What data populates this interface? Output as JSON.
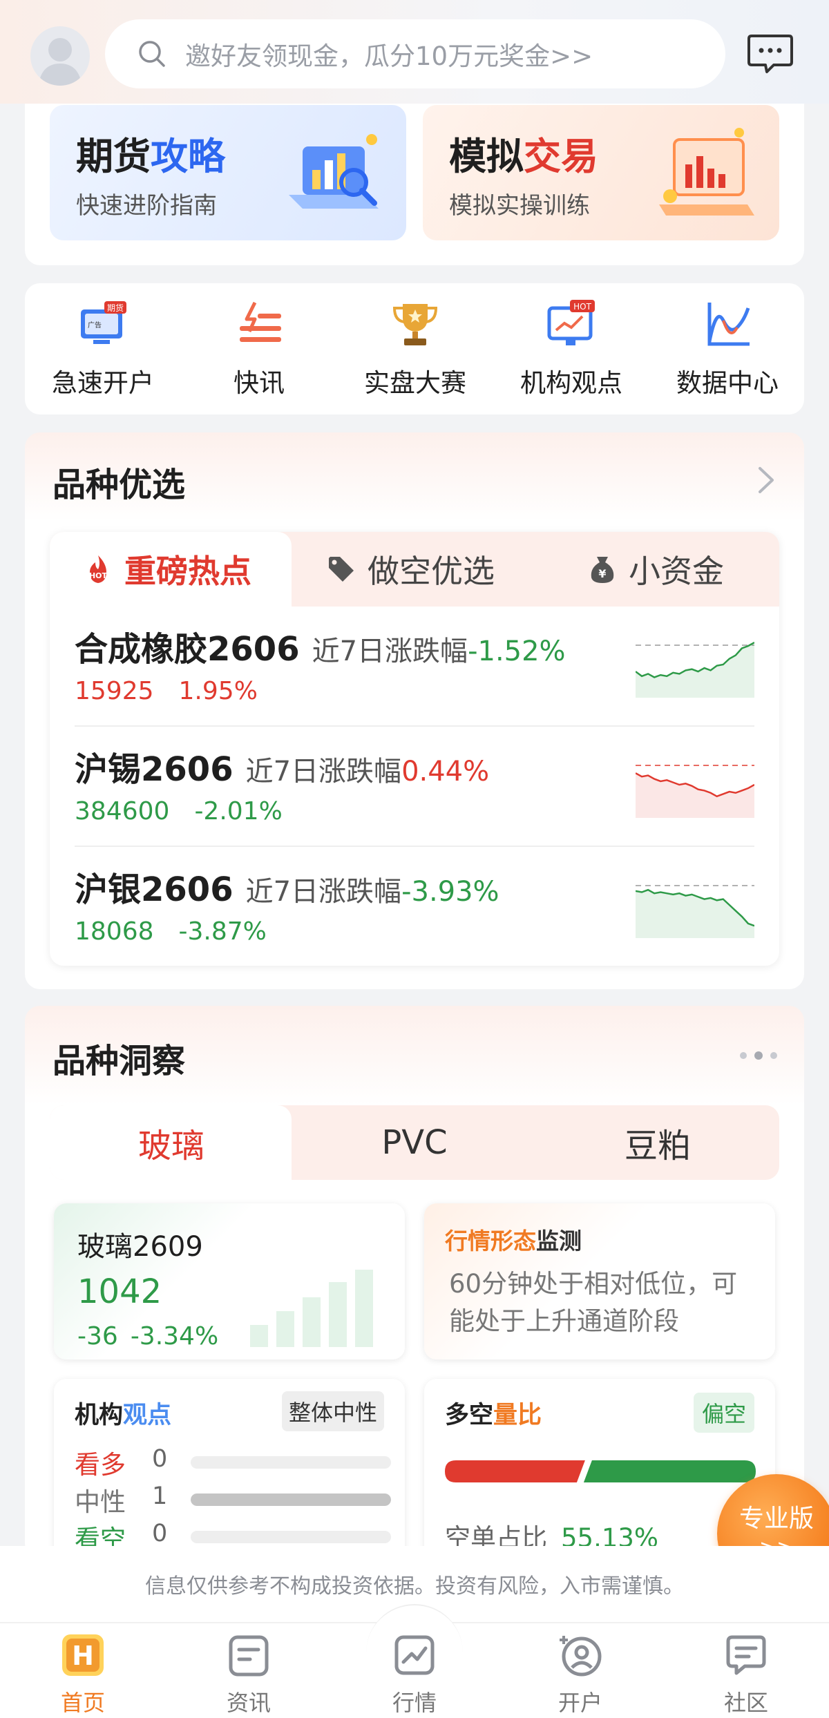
{
  "search": {
    "placeholder": "邀好友领现金，瓜分10万元奖金>>"
  },
  "banners": [
    {
      "title_a": "期货",
      "title_b": "攻略",
      "subtitle": "快速进阶指南"
    },
    {
      "title_a": "模拟",
      "title_b": "交易",
      "subtitle": "模拟实操训练"
    }
  ],
  "quick": {
    "items": [
      {
        "label": "急速开户",
        "icon": "account-monitor-icon",
        "badge": "期货",
        "badge2": "广告"
      },
      {
        "label": "快讯",
        "icon": "news-flash-icon"
      },
      {
        "label": "实盘大赛",
        "icon": "trophy-icon"
      },
      {
        "label": "机构观点",
        "icon": "hot-board-icon",
        "badge": "HOT"
      },
      {
        "label": "数据中心",
        "icon": "data-chart-icon"
      }
    ]
  },
  "picks": {
    "title": "品种优选",
    "tabs": [
      {
        "label": "重磅热点",
        "icon": "hot-fire-icon",
        "icon_text": "HOT"
      },
      {
        "label": "做空优选",
        "icon": "tag-icon"
      },
      {
        "label": "小资金",
        "icon": "money-bag-icon",
        "icon_text": "¥"
      }
    ],
    "rows": [
      {
        "name": "合成橡胶2606",
        "range_label": "近7日涨跌幅",
        "range_pct": "-1.52%",
        "price": "15925",
        "change": "1.95%",
        "price_dir": "up",
        "range_dir": "dn",
        "spark": [
          0.62,
          0.7,
          0.66,
          0.72,
          0.68,
          0.7,
          0.64,
          0.66,
          0.6,
          0.58,
          0.62,
          0.56,
          0.6,
          0.52,
          0.5,
          0.4,
          0.34,
          0.22,
          0.18,
          0.12
        ]
      },
      {
        "name": "沪锡2606",
        "range_label": "近7日涨跌幅",
        "range_pct": "0.44%",
        "price": "384600",
        "change": "-2.01%",
        "price_dir": "dn",
        "range_dir": "up",
        "spark": [
          0.3,
          0.36,
          0.34,
          0.4,
          0.44,
          0.42,
          0.46,
          0.5,
          0.48,
          0.52,
          0.58,
          0.6,
          0.64,
          0.7,
          0.66,
          0.62,
          0.64,
          0.6,
          0.56,
          0.5
        ]
      },
      {
        "name": "沪银2606",
        "range_label": "近7日涨跌幅",
        "range_pct": "-3.93%",
        "price": "18068",
        "change": "-3.87%",
        "price_dir": "dn",
        "range_dir": "dn",
        "spark": [
          0.26,
          0.28,
          0.24,
          0.3,
          0.28,
          0.3,
          0.32,
          0.3,
          0.34,
          0.32,
          0.36,
          0.4,
          0.38,
          0.42,
          0.4,
          0.5,
          0.6,
          0.7,
          0.82,
          0.86
        ]
      }
    ]
  },
  "insight": {
    "title": "品种洞察",
    "tabs": [
      "玻璃",
      "PVC",
      "豆粕"
    ],
    "quote": {
      "name": "玻璃2609",
      "price": "1042",
      "change": "-36",
      "change_pct": "-3.34%"
    },
    "pattern": {
      "title_hl": "行情形态",
      "title_rest": "监测",
      "text": "60分钟处于相对低位，可能处于上升通道阶段"
    },
    "institution": {
      "title_a": "机构",
      "title_b": "观点",
      "badge": "整体中性",
      "rows": [
        {
          "label": "看多",
          "value": "0",
          "color": "#e03a2f",
          "fill": 0
        },
        {
          "label": "中性",
          "value": "1",
          "color": "#777777",
          "fill": 1
        },
        {
          "label": "看空",
          "value": "0",
          "color": "#2e9a48",
          "fill": 0
        }
      ]
    },
    "ratio": {
      "title_a": "多空",
      "title_b": "量比",
      "badge": "偏空",
      "label": "空单占比",
      "value": "55.13%",
      "short_share": 0.5513
    }
  },
  "pro_button": {
    "line1": "专业版",
    "line2": ">>"
  },
  "disclaimer": "信息仅供参考不构成投资依据。投资有风险，入市需谨慎。",
  "nav": [
    {
      "label": "首页",
      "icon": "home-icon",
      "active": true
    },
    {
      "label": "资讯",
      "icon": "news-icon"
    },
    {
      "label": "行情",
      "icon": "market-chart-icon"
    },
    {
      "label": "开户",
      "icon": "open-account-icon"
    },
    {
      "label": "社区",
      "icon": "community-icon"
    }
  ],
  "colors": {
    "up": "#e03a2f",
    "down": "#2e9a48",
    "accent": "#f07a22",
    "blue": "#2d67f0"
  }
}
